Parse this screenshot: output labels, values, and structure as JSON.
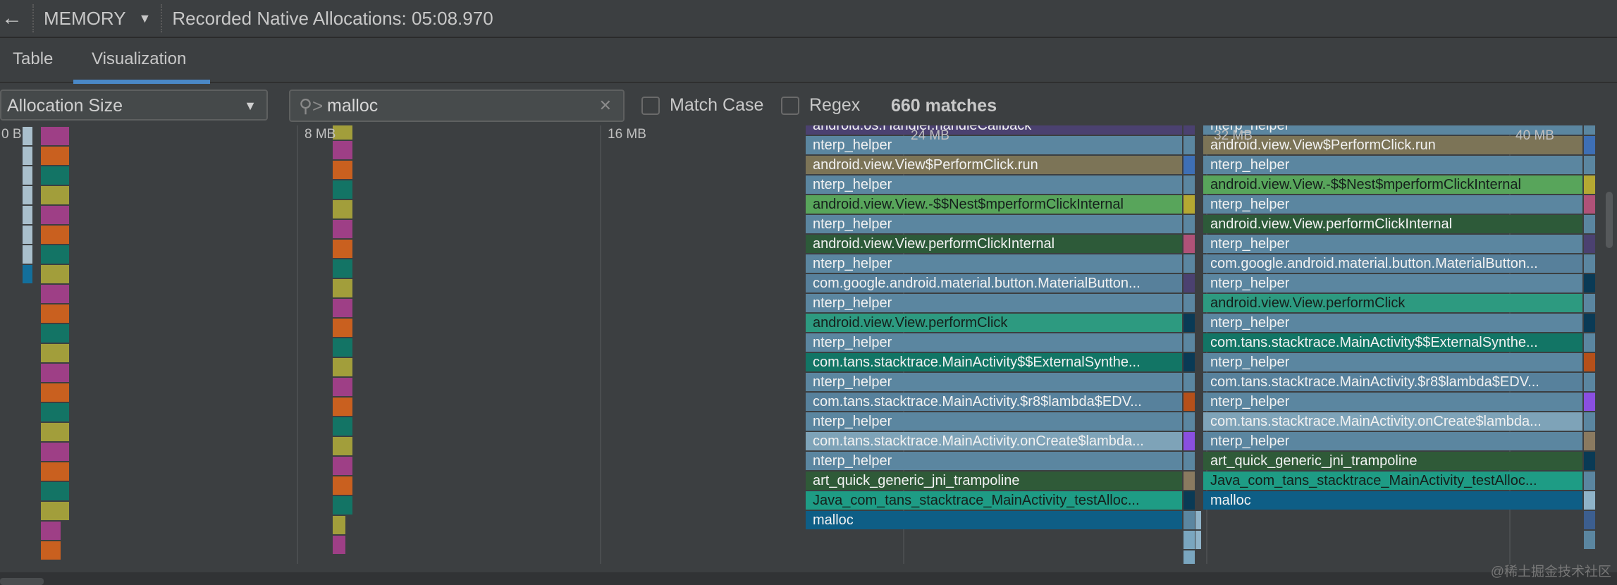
{
  "header": {
    "back_icon": "arrow-left-icon",
    "profiler": "MEMORY",
    "recording": "Recorded Native Allocations: 05:08.970"
  },
  "tabs": [
    {
      "label": "Table",
      "active": false
    },
    {
      "label": "Visualization",
      "active": true
    }
  ],
  "toolbar": {
    "sort_by": "Allocation Size",
    "search_value": "malloc",
    "match_case": {
      "label": "Match Case",
      "checked": false
    },
    "regex": {
      "label": "Regex",
      "checked": false
    },
    "matches": "660 matches"
  },
  "axis_ticks": [
    "0 B",
    "8 MB",
    "16 MB",
    "24 MB",
    "32 MB",
    "40 MB"
  ],
  "colors": {
    "nterp": "#5b86a0",
    "run": "#7c7457",
    "nest": "#58a55b",
    "internal": "#2d5a39",
    "material": "#57809b",
    "ext": "#127565",
    "click": "#2d9a80",
    "r8": "#57819c",
    "oncreate": "#7ea3b8",
    "art": "#2f5a38",
    "jni": "#1e9c85",
    "malloc": "#0e5e86",
    "handler": "#4b4170"
  },
  "mini_palette": [
    "#9e3f86",
    "#c9601f",
    "#137465",
    "#a29e3b"
  ],
  "flame_left": [
    {
      "label": "android.os.Handler.handleCallback",
      "c": "handler",
      "side": "#4b4170"
    },
    {
      "label": "nterp_helper",
      "c": "nterp",
      "side": "#5b86a0"
    },
    {
      "label": "android.view.View$PerformClick.run",
      "c": "run",
      "side": "#3e6fb5"
    },
    {
      "label": "nterp_helper",
      "c": "nterp",
      "side": "#5b86a0"
    },
    {
      "label": "android.view.View.-$$Nest$mperformClickInternal",
      "c": "nest",
      "side": "#b5a832",
      "dark": true
    },
    {
      "label": "nterp_helper",
      "c": "nterp",
      "side": "#5b86a0"
    },
    {
      "label": "android.view.View.performClickInternal",
      "c": "internal",
      "side": "#b05278"
    },
    {
      "label": "nterp_helper",
      "c": "nterp",
      "side": "#5b86a0"
    },
    {
      "label": "com.google.android.material.button.MaterialButton...",
      "c": "material",
      "side": "#4b4170"
    },
    {
      "label": "nterp_helper",
      "c": "nterp",
      "side": "#5b86a0"
    },
    {
      "label": "android.view.View.performClick",
      "c": "click",
      "side": "#0a3a55",
      "dark": true
    },
    {
      "label": "nterp_helper",
      "c": "nterp",
      "side": "#5b86a0"
    },
    {
      "label": "com.tans.stacktrace.MainActivity$$ExternalSynthe...",
      "c": "ext",
      "side": "#0a3a55"
    },
    {
      "label": "nterp_helper",
      "c": "nterp",
      "side": "#5b86a0"
    },
    {
      "label": "com.tans.stacktrace.MainActivity.$r8$lambda$EDV...",
      "c": "r8",
      "side": "#b5501a"
    },
    {
      "label": "nterp_helper",
      "c": "nterp",
      "side": "#5b86a0"
    },
    {
      "label": "com.tans.stacktrace.MainActivity.onCreate$lambda...",
      "c": "oncreate",
      "side": "#8a4fe0"
    },
    {
      "label": "nterp_helper",
      "c": "nterp",
      "side": "#5b86a0"
    },
    {
      "label": "art_quick_generic_jni_trampoline",
      "c": "art",
      "side": "#8a7a60"
    },
    {
      "label": "Java_com_tans_stacktrace_MainActivity_testAlloc...",
      "c": "jni",
      "side": "#0a3a55",
      "dark": true
    },
    {
      "label": "malloc",
      "c": "malloc",
      "side": "#5b86a0"
    }
  ],
  "flame_right": [
    {
      "label": "nterp_helper",
      "c": "nterp",
      "side": "#5b86a0"
    },
    {
      "label": "android.view.View$PerformClick.run",
      "c": "run",
      "side": "#3e6fb5"
    },
    {
      "label": "nterp_helper",
      "c": "nterp",
      "side": "#5b86a0"
    },
    {
      "label": "android.view.View.-$$Nest$mperformClickInternal",
      "c": "nest",
      "side": "#b5a832",
      "dark": true
    },
    {
      "label": "nterp_helper",
      "c": "nterp",
      "side": "#b05278"
    },
    {
      "label": "android.view.View.performClickInternal",
      "c": "internal",
      "side": "#5b86a0"
    },
    {
      "label": "nterp_helper",
      "c": "nterp",
      "side": "#4b4170"
    },
    {
      "label": "com.google.android.material.button.MaterialButton...",
      "c": "material",
      "side": "#5b86a0"
    },
    {
      "label": "nterp_helper",
      "c": "nterp",
      "side": "#0a3a55"
    },
    {
      "label": "android.view.View.performClick",
      "c": "click",
      "side": "#5b86a0",
      "dark": true
    },
    {
      "label": "nterp_helper",
      "c": "nterp",
      "side": "#0a3a55"
    },
    {
      "label": "com.tans.stacktrace.MainActivity$$ExternalSynthe...",
      "c": "ext",
      "side": "#5b86a0"
    },
    {
      "label": "nterp_helper",
      "c": "nterp",
      "side": "#b5501a"
    },
    {
      "label": "com.tans.stacktrace.MainActivity.$r8$lambda$EDV...",
      "c": "r8",
      "side": "#5b86a0"
    },
    {
      "label": "nterp_helper",
      "c": "nterp",
      "side": "#8a4fe0"
    },
    {
      "label": "com.tans.stacktrace.MainActivity.onCreate$lambda...",
      "c": "oncreate",
      "side": "#5b86a0"
    },
    {
      "label": "nterp_helper",
      "c": "nterp",
      "side": "#8a7a60"
    },
    {
      "label": "art_quick_generic_jni_trampoline",
      "c": "art",
      "side": "#0a3a55"
    },
    {
      "label": "Java_com_tans_stacktrace_MainActivity_testAlloc...",
      "c": "jni",
      "side": "#5b86a0",
      "dark": true
    },
    {
      "label": "malloc",
      "c": "malloc",
      "side": "#8fb3c8"
    }
  ],
  "watermark": "@稀土掘金技术社区"
}
